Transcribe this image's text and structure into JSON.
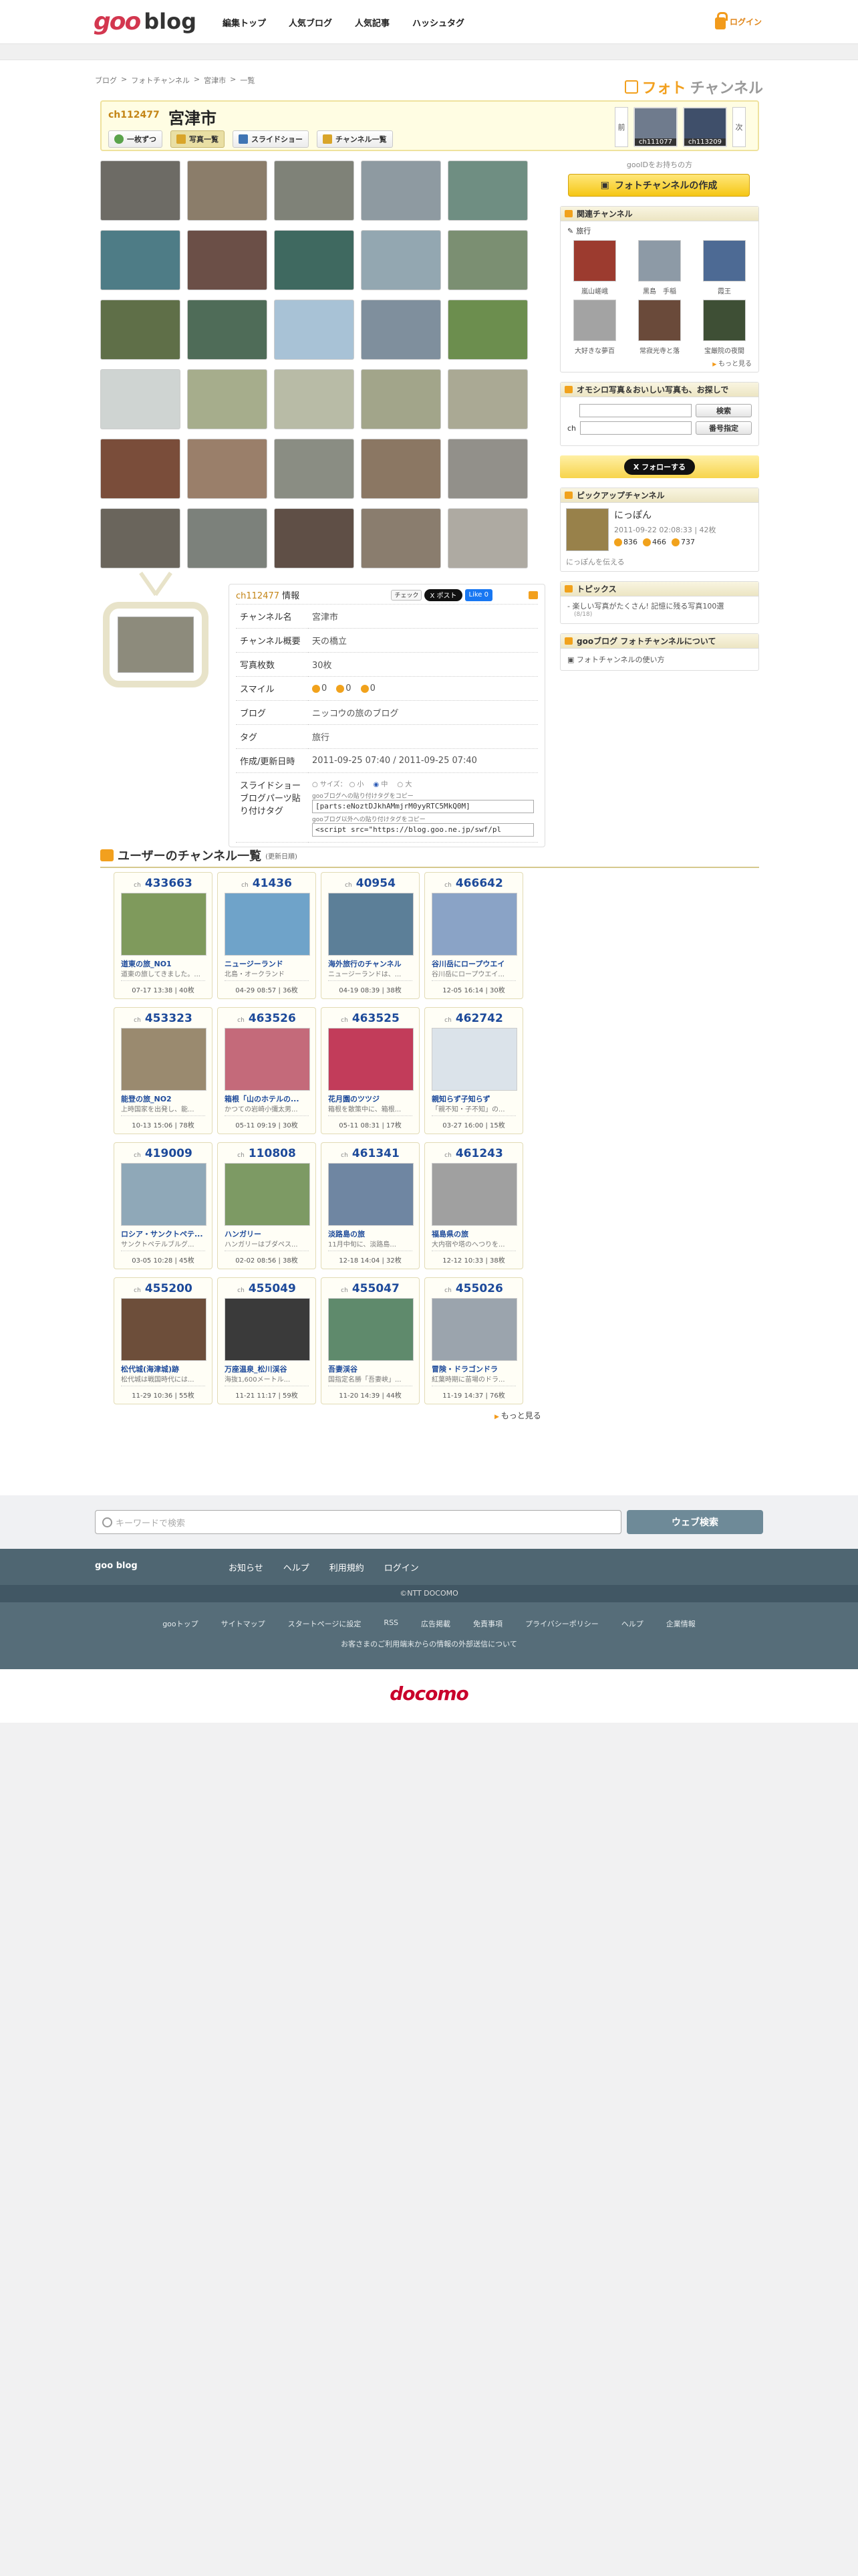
{
  "header": {
    "logo_goo": "goo",
    "logo_blog": "blog",
    "nav": [
      "編集トップ",
      "人気ブログ",
      "人気記事",
      "ハッシュタグ"
    ],
    "login": "ログイン"
  },
  "breadcrumb": [
    "ブログ",
    "フォトチャンネル",
    "宮津市",
    "一覧"
  ],
  "brand": {
    "photo": "フォト",
    "channel": "チャンネル"
  },
  "channel": {
    "id": "ch112477",
    "name": "宮津市",
    "tabs": [
      "一枚ずつ",
      "写真一覧",
      "スライドショー",
      "チャンネル一覧"
    ],
    "prev_label": "前",
    "next_label": "次",
    "prev_id": "ch111077",
    "next_id": "ch113209"
  },
  "photo_colors": [
    "#6d6b65",
    "#8b7d6a",
    "#7f8278",
    "#8e9aa1",
    "#6f8e82",
    "#4e7c86",
    "#6b4f47",
    "#3f6960",
    "#93a7b1",
    "#7b8f72",
    "#5f6f48",
    "#4f6c58",
    "#a8c2d6",
    "#7f8f9d",
    "#6c8e4e",
    "#cfd4d2",
    "#a6ad8c",
    "#b8bba6",
    "#a2a58a",
    "#aaa994",
    "#7a4d3a",
    "#9a7f6a",
    "#8a8d83",
    "#8b7763",
    "#92908a",
    "#6a655c",
    "#7c817b",
    "#5f4f46",
    "#8a7d6e",
    "#aeaaa2"
  ],
  "sidebar": {
    "note": "gooIDをお持ちの方",
    "make_button": "フォトチャンネルの作成",
    "related": {
      "title": "関連チャンネル",
      "category": "旅行",
      "items": [
        "嵐山嵯峨",
        "黒島　手稲",
        "霞王",
        "大好きな夢百",
        "常寂光寺と落",
        "宝厳院の夜間"
      ],
      "colors": [
        "#9c3b2f",
        "#8d9aa6",
        "#4d6a94",
        "#a3a3a3",
        "#6a4a3a",
        "#3e4f35"
      ],
      "more": "もっと見る"
    },
    "search": {
      "title": "オモシロ写真＆おいしい写真も、お探しで",
      "search_btn": "検索",
      "ch_label": "ch",
      "id_btn": "番号指定"
    },
    "follow": "X フォローする",
    "pickup": {
      "title": "ピックアップチャンネル",
      "name": "にっぽん",
      "meta": "2011-09-22 02:08:33 | 42枚",
      "s1": "836",
      "s2": "466",
      "s3": "737",
      "foot": "にっぽんを伝える"
    },
    "topics": {
      "title": "トピックス",
      "item": "楽しい写真がたくさん! 記憶に残る写真100選",
      "sub": "(8/18)"
    },
    "about": {
      "title": "gooブログ フォトチャンネルについて",
      "item": "フォトチャンネルの使い方"
    }
  },
  "info": {
    "title_id": "ch112477",
    "title_suffix": " 情報",
    "check": "チェック",
    "post": "X ポスト",
    "like": "Like 0",
    "labels": [
      "チャンネル名",
      "チャンネル概要",
      "写真枚数",
      "スマイル",
      "ブログ",
      "タグ",
      "作成/更新日時",
      "スライドショーブログパーツ貼り付けタグ"
    ],
    "name": "宮津市",
    "summary": "天の橋立",
    "count": "30枚",
    "smile": [
      "0",
      "0",
      "0"
    ],
    "blog": "ニッコウの旅のブログ",
    "tag": "旅行",
    "dates": "2011-09-25 07:40 / 2011-09-25 07:40",
    "size_label": "サイズ：",
    "sizes": [
      "小",
      "中",
      "大"
    ],
    "lbl1": "gooブログへの貼り付けタグをコピー",
    "val1": "[parts:eNoztDJkhAMmjrM0yyRTC5MkQ0M]",
    "lbl2": "gooブログ以外への貼り付けタグをコピー",
    "val2": "<script src=\"https://blog.goo.ne.jp/swf/pl"
  },
  "users": {
    "title": "ユーザーのチャンネル一覧",
    "sub": "(更新日順)",
    "more": "もっと見る",
    "cards": [
      {
        "id": "433663",
        "t": "道東の旅_NO1",
        "d": "道東の旅してきました。...",
        "f": "07-17 13:38 | 40枚",
        "c": "#7f9a5c"
      },
      {
        "id": "41436",
        "t": "ニュージーランド",
        "d": "北島・オークランド",
        "f": "04-29 08:57 | 36枚",
        "c": "#6fa3c9"
      },
      {
        "id": "40954",
        "t": "海外旅行のチャンネル",
        "d": "ニュージーランドは、...",
        "f": "04-19 08:39 | 38枚",
        "c": "#5c7f98"
      },
      {
        "id": "466642",
        "t": "谷川岳にロープウエイ",
        "d": "谷川岳にロープウエイ...",
        "f": "12-05 16:14 | 30枚",
        "c": "#8aa3c6"
      },
      {
        "id": "453323",
        "t": "能登の旅_NO2",
        "d": "上時国家を出発し、能...",
        "f": "10-13 15:06 | 78枚",
        "c": "#9a8a6f"
      },
      {
        "id": "463526",
        "t": "箱根「山のホテルの...",
        "d": "かつての岩崎小彌太男...",
        "f": "05-11 09:19 | 30枚",
        "c": "#c46a7a"
      },
      {
        "id": "463525",
        "t": "花月園のツツジ",
        "d": "箱根を散策中に、箱根...",
        "f": "05-11 08:31 | 17枚",
        "c": "#c23c5a"
      },
      {
        "id": "462742",
        "t": "親知らず子知らず",
        "d": "「親不知・子不知」の...",
        "f": "03-27 16:00 | 15枚",
        "c": "#dbe3ea"
      },
      {
        "id": "419009",
        "t": "ロシア・サンクトペテ...",
        "d": "サンクトペテルブルグ...",
        "f": "03-05 10:28 | 45枚",
        "c": "#8fa8b8"
      },
      {
        "id": "110808",
        "t": "ハンガリー",
        "d": "ハンガリーはブダペス...",
        "f": "02-02 08:56 | 38枚",
        "c": "#7d9a64"
      },
      {
        "id": "461341",
        "t": "淡路島の旅",
        "d": "11月中旬に、淡路島...",
        "f": "12-18 14:04 | 32枚",
        "c": "#6f86a2"
      },
      {
        "id": "461243",
        "t": "福島県の旅",
        "d": "大内宿や塔のへつりを...",
        "f": "12-12 10:33 | 38枚",
        "c": "#a0a0a0"
      },
      {
        "id": "455200",
        "t": "松代城(海津城)跡",
        "d": "松代城は戦国時代には...",
        "f": "11-29 10:36 | 55枚",
        "c": "#6d4e3a"
      },
      {
        "id": "455049",
        "t": "万座温泉_松川渓谷",
        "d": "海抜1,600メートル...",
        "f": "11-21 11:17 | 59枚",
        "c": "#3a3a3a"
      },
      {
        "id": "455047",
        "t": "吾妻渓谷",
        "d": "国指定名勝「吾妻峡」...",
        "f": "11-20 14:39 | 44枚",
        "c": "#5f8a6c"
      },
      {
        "id": "455026",
        "t": "冒険・ドラゴンドラ",
        "d": "紅葉時期に苗場のドラ...",
        "f": "11-19 14:37 | 76枚",
        "c": "#9ba4ad"
      }
    ]
  },
  "footer": {
    "search_placeholder": "キーワードで検索",
    "search_btn": "ウェブ検索",
    "brand": "goo blog",
    "links": [
      "お知らせ",
      "ヘルプ",
      "利用規約",
      "ログイン"
    ],
    "copyright": "©NTT DOCOMO",
    "links2": [
      "gooトップ",
      "サイトマップ",
      "スタートページに設定",
      "RSS",
      "広告掲載",
      "免責事項",
      "プライバシーポリシー",
      "ヘルプ",
      "企業情報"
    ],
    "notice": "お客さまのご利用端末からの情報の外部送信について",
    "docomo": "docomo"
  }
}
